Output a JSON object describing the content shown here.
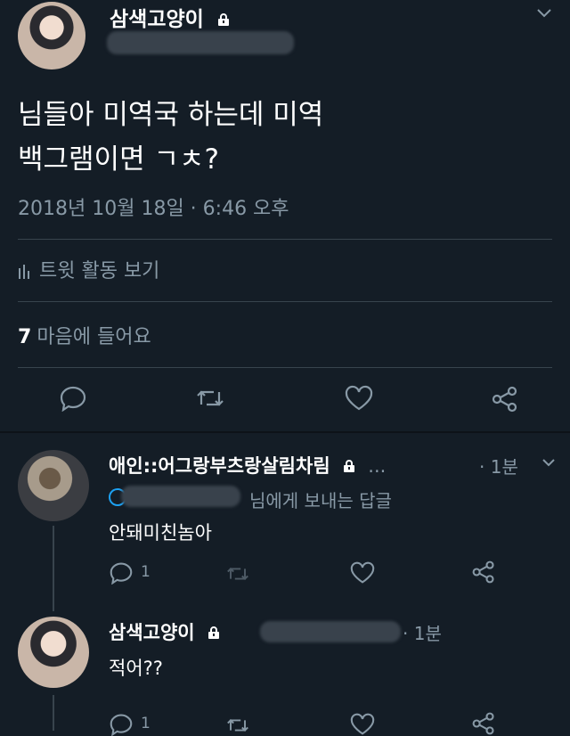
{
  "main_tweet": {
    "display_name": "삼색고양이",
    "text_line1": "님들아 미역국 하는데 미역",
    "text_line2": "백그램이면 ㄱㅊ?",
    "timestamp": "2018년 10월 18일 · 6:46 오후",
    "activity_label": "트윗 활동 보기",
    "likes_count": "7",
    "likes_label": "마음에 들어요"
  },
  "reply1": {
    "display_name": "애인::어그랑부츠랑살림차림",
    "ellipsis": "...",
    "time": "· 1분",
    "reply_to_suffix": "님에게 보내는 답글",
    "text": "안돼미친놈아",
    "reply_count": "1"
  },
  "reply2": {
    "display_name": "삼색고양이",
    "time": "· 1분",
    "text": "적어??",
    "reply_count": "1"
  },
  "colors": {
    "background": "#141d26",
    "muted_text": "#8899a6",
    "divider": "#38444d",
    "mention": "#1da1f2"
  },
  "icons": [
    "chevron-down-icon",
    "lock-icon",
    "bar-chart-icon",
    "reply-icon",
    "retweet-icon",
    "heart-icon",
    "share-icon"
  ]
}
